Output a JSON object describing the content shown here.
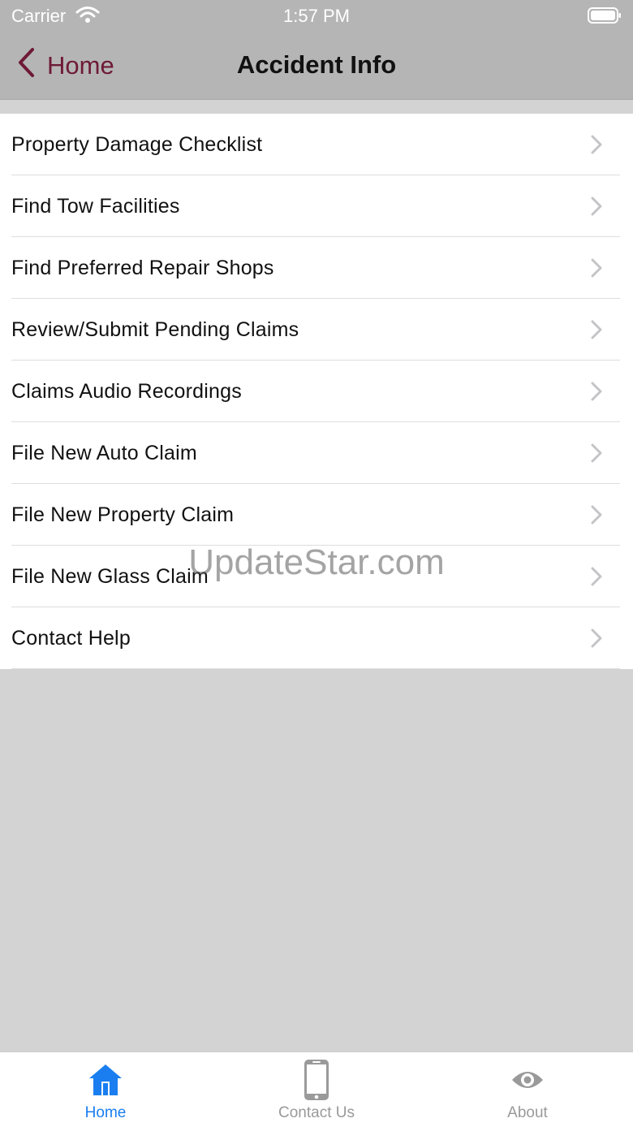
{
  "status_bar": {
    "carrier": "Carrier",
    "time": "1:57 PM"
  },
  "nav": {
    "back_label": "Home",
    "title": "Accident Info"
  },
  "menu": {
    "items": [
      {
        "label": "Property Damage Checklist"
      },
      {
        "label": "Find Tow Facilities"
      },
      {
        "label": "Find Preferred Repair Shops"
      },
      {
        "label": "Review/Submit Pending Claims"
      },
      {
        "label": "Claims Audio Recordings"
      },
      {
        "label": "File New Auto Claim"
      },
      {
        "label": "File New Property Claim"
      },
      {
        "label": "File New Glass Claim"
      },
      {
        "label": "Contact Help"
      }
    ]
  },
  "watermark": "UpdateStar.com",
  "tabs": [
    {
      "label": "Home",
      "icon": "home-icon",
      "active": true
    },
    {
      "label": "Contact Us",
      "icon": "phone-icon",
      "active": false
    },
    {
      "label": "About",
      "icon": "eye-icon",
      "active": false
    }
  ],
  "colors": {
    "accent": "#6e1a36",
    "tab_active": "#1a7ef0",
    "tab_inactive": "#9a9a9a",
    "bar_bg": "#b5b5b5",
    "page_bg": "#d3d3d3"
  }
}
